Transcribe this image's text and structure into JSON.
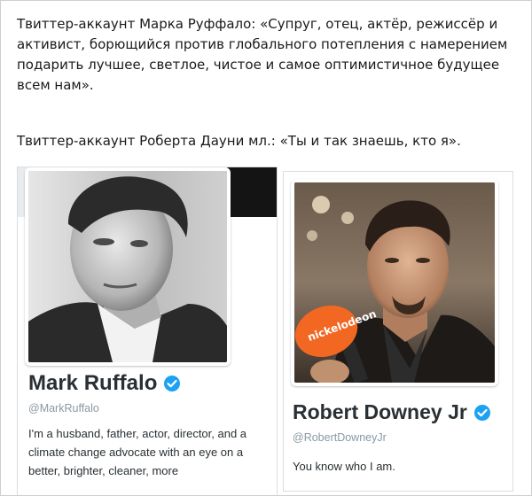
{
  "captions": {
    "ruffalo": "Твиттер-аккаунт Марка Руффало: «Супруг, отец, актёр, режиссёр и активист, борющийся против глобального потепления с намерением подарить лучшее, светлое, чистое и самое оптимистичное будущее всем нам».",
    "downey": "Твиттер-аккаунт Роберта Дауни мл.: «Ты и так знаешь, кто я»."
  },
  "profiles": [
    {
      "name": "Mark Ruffalo",
      "handle": "@MarkRuffalo",
      "verified": true,
      "bio": "I'm a husband, father, actor, director, and a climate change advocate with an eye on a better, brighter, cleaner, more",
      "avatar_icon": "profile-photo"
    },
    {
      "name": "Robert Downey Jr",
      "handle": "@RobertDowneyJr",
      "verified": true,
      "bio": "You know who I am.",
      "avatar_icon": "profile-photo",
      "microphone_label": "nickelodeon"
    }
  ],
  "colors": {
    "verified_blue": "#1da1f2",
    "name_text": "#292f33",
    "handle_text": "#8899a6",
    "mic_orange": "#f26722"
  }
}
